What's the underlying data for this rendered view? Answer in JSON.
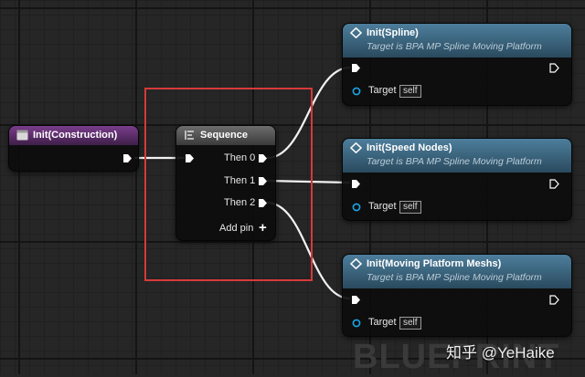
{
  "colors": {
    "construction_header": "#6a3579",
    "sequence_header": "#555555",
    "function_header": "#44708c",
    "highlight": "#d63a3a",
    "exec_pin": "#ffffff",
    "object_pin": "#1aa6e8"
  },
  "nodes": {
    "construction": {
      "title": "Init(Construction)",
      "icon": "event-icon"
    },
    "sequence": {
      "title": "Sequence",
      "icon": "sequence-icon",
      "pins": [
        "Then 0",
        "Then 1",
        "Then 2"
      ],
      "add_pin_label": "Add pin"
    },
    "functions": [
      {
        "title": "Init(Spline)",
        "subtitle": "Target is BPA MP Spline Moving Platform",
        "target_label": "Target",
        "self_value": "self"
      },
      {
        "title": "Init(Speed Nodes)",
        "subtitle": "Target is BPA MP Spline Moving Platform",
        "target_label": "Target",
        "self_value": "self"
      },
      {
        "title": "Init(Moving Platform Meshs)",
        "subtitle": "Target is BPA MP Spline Moving Platform",
        "target_label": "Target",
        "self_value": "self"
      }
    ]
  },
  "watermark": {
    "text": "BLUEPRINT"
  },
  "attribution": {
    "text": "知乎 @YeHaike"
  }
}
